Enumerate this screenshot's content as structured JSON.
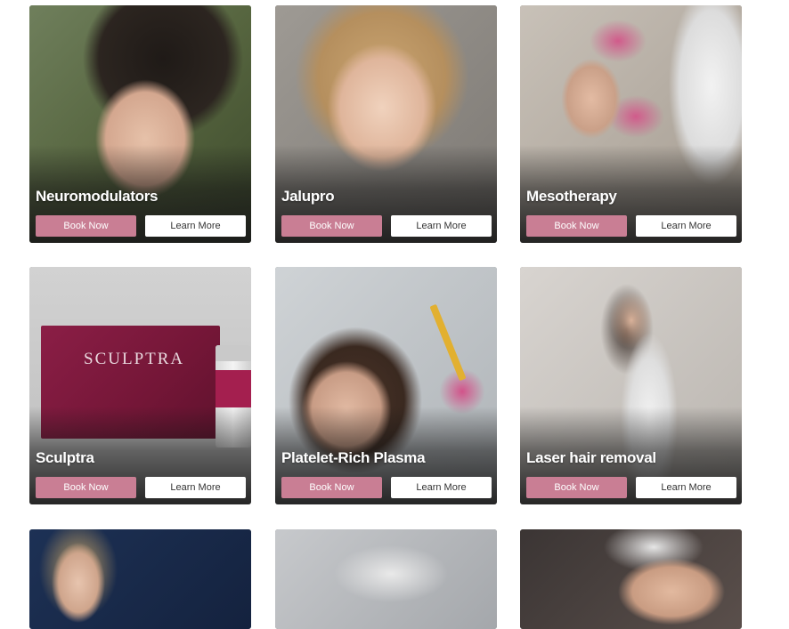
{
  "colors": {
    "book_button": "#c97e94",
    "learn_button": "#ffffff",
    "title_text": "#ffffff"
  },
  "cards": [
    {
      "title": "Neuromodulators",
      "book_label": "Book Now",
      "learn_label": "Learn More"
    },
    {
      "title": "Jalupro",
      "book_label": "Book Now",
      "learn_label": "Learn More"
    },
    {
      "title": "Mesotherapy",
      "book_label": "Book Now",
      "learn_label": "Learn More"
    },
    {
      "title": "Sculptra",
      "book_label": "Book Now",
      "learn_label": "Learn More",
      "product_brand": "SCULPTRA"
    },
    {
      "title": "Platelet-Rich Plasma",
      "book_label": "Book Now",
      "learn_label": "Learn More"
    },
    {
      "title": "Laser hair removal",
      "book_label": "Book Now",
      "learn_label": "Learn More"
    }
  ]
}
